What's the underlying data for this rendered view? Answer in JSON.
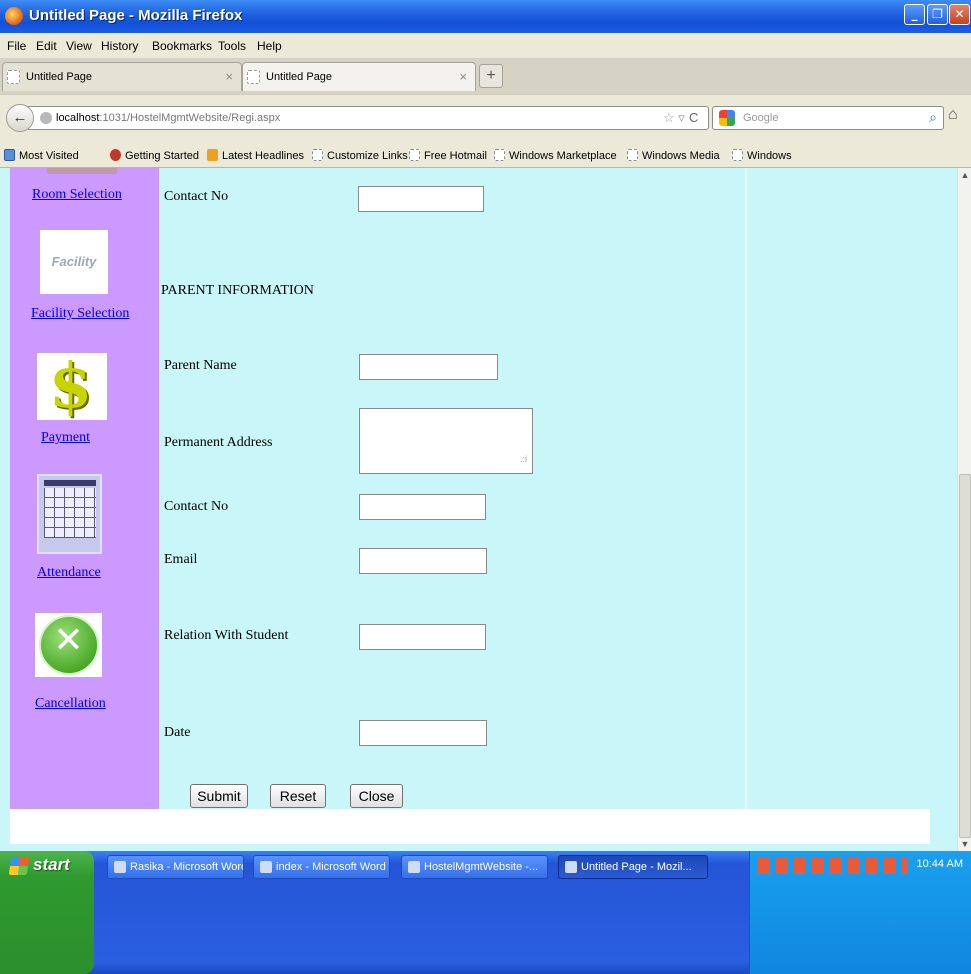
{
  "window": {
    "title": "Untitled Page - Mozilla Firefox",
    "controls": [
      "_",
      "❐",
      "✕"
    ]
  },
  "menu": [
    "File",
    "Edit",
    "View",
    "History",
    "Bookmarks",
    "Tools",
    "Help"
  ],
  "tabs": [
    {
      "label": "Untitled Page",
      "close": "×"
    },
    {
      "label": "Untitled Page",
      "close": "×"
    }
  ],
  "newtab": "+",
  "nav": {
    "back": "←",
    "url_host": "localhost",
    "url_path": ":1031/HostelMgmtWebsite/Regi.aspx",
    "star": "☆ ▿",
    "reload": "C",
    "search_placeholder": "Google",
    "search_icon": "⌕",
    "home": "⌂"
  },
  "bookmarks": [
    "Most Visited",
    "Getting Started",
    "Latest Headlines",
    "Customize Links",
    "Free Hotmail",
    "Windows Marketplace",
    "Windows Media",
    "Windows"
  ],
  "sidebar": {
    "links": [
      "Room Selection",
      "Facility Selection",
      "Payment",
      "Attendance",
      "Cancellation"
    ],
    "facility_logo_text": "Facility",
    "payment_glyph": "$",
    "cancel_glyph": "✕"
  },
  "form": {
    "contact_label": "Contact No",
    "section_heading": "PARENT INFORMATION",
    "fields": [
      "Parent Name",
      "Permanent Address",
      "Contact No",
      "Email",
      "Relation With Student",
      "Date"
    ],
    "grip": ".:i",
    "buttons": [
      "Submit",
      "Reset",
      "Close"
    ]
  },
  "scrollbar": {
    "up": "▲",
    "down": "▼"
  },
  "taskbar": {
    "start": "start",
    "items": [
      "Rasika - Microsoft Word",
      "index - Microsoft Word",
      "HostelMgmtWebsite -...",
      "Untitled Page - Mozil..."
    ],
    "time": "10:44 AM"
  },
  "colors": {
    "page_bg": "#c9f6f8",
    "sidebar_bg": "#cc99ff",
    "link": "#0000ee",
    "titlebar": "#1d5fe0",
    "taskbar": "#2a5fe0"
  }
}
